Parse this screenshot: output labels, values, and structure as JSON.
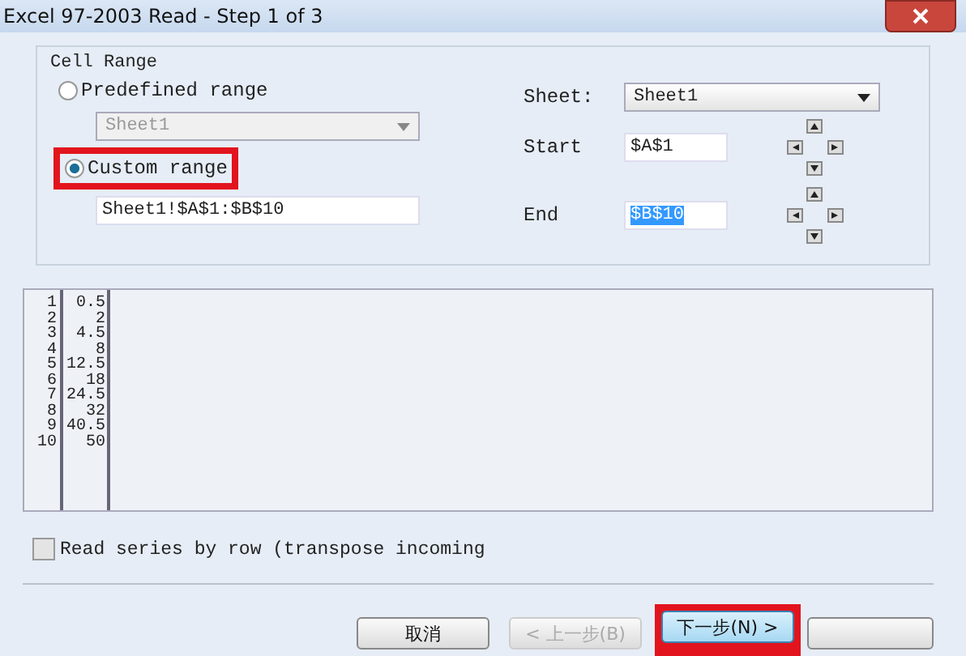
{
  "window": {
    "title": "Excel 97-2003 Read - Step 1 of 3"
  },
  "cell_range": {
    "title": "Cell Range",
    "options": [
      {
        "label": "Predefined range",
        "selected": false,
        "highlighted": false
      },
      {
        "label": "Custom range",
        "selected": true,
        "highlighted": true
      }
    ],
    "predefined_value": "Sheet1",
    "custom_value": "Sheet1!$A$1:$B$10",
    "sheet_label": "Sheet:",
    "sheet_value": "Sheet1",
    "start_label": "Start",
    "start_value": "$A$1",
    "end_label": "End",
    "end_value": "$B$10"
  },
  "preview": {
    "rows": [
      [
        "1",
        "0.5"
      ],
      [
        "2",
        "2"
      ],
      [
        "3",
        "4.5"
      ],
      [
        "4",
        "8"
      ],
      [
        "5",
        "12.5"
      ],
      [
        "6",
        "18"
      ],
      [
        "7",
        "24.5"
      ],
      [
        "8",
        "32"
      ],
      [
        "9",
        "40.5"
      ],
      [
        "10",
        "50"
      ]
    ]
  },
  "transpose": {
    "label": "Read series by row (transpose incoming",
    "checked": false
  },
  "buttons": [
    {
      "label": "取消",
      "disabled": false,
      "highlighted": false
    },
    {
      "label": "< 上一步(B)",
      "disabled": true,
      "highlighted": false
    },
    {
      "label": "下一步(N) >",
      "disabled": false,
      "highlighted": true
    }
  ]
}
